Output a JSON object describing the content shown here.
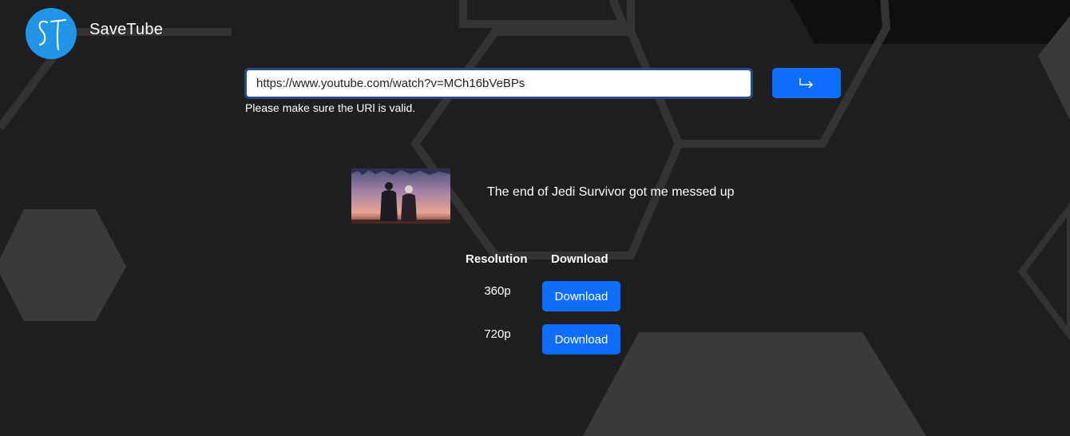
{
  "header": {
    "brand": "SaveTube",
    "logo_text": "ST"
  },
  "search": {
    "url_value": "https://www.youtube.com/watch?v=MCh16bVeBPs",
    "hint": "Please make sure the URl is valid.",
    "submit_icon": "arrow-turn-right-icon"
  },
  "video": {
    "title": "The end of Jedi Survivor got me messed up"
  },
  "table": {
    "headers": {
      "resolution": "Resolution",
      "download": "Download"
    },
    "rows": [
      {
        "resolution": "360p",
        "button": "Download"
      },
      {
        "resolution": "720p",
        "button": "Download"
      }
    ]
  },
  "colors": {
    "background": "#1f1f21",
    "accent": "#0d6efd",
    "logo": "#2196e8"
  }
}
